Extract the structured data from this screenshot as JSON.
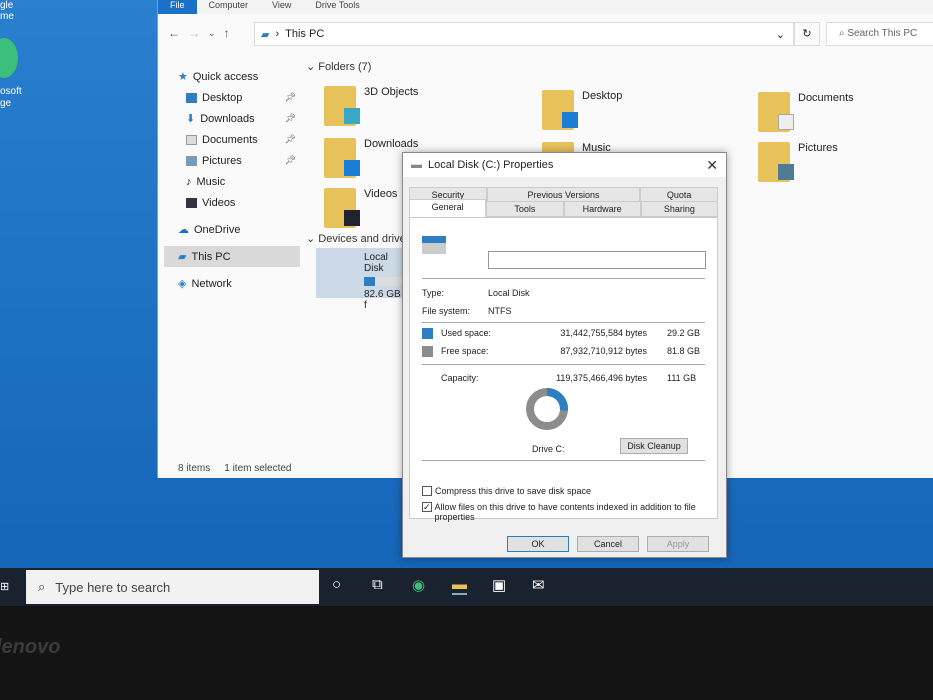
{
  "desktop": {
    "icons": [
      "gle",
      "me",
      "osoft",
      "ge"
    ]
  },
  "explorer": {
    "ribbon_tabs": [
      "File",
      "Computer",
      "View",
      "Drive Tools"
    ],
    "address": "This PC",
    "search_placeholder": "Search This PC",
    "nav": [
      {
        "label": "Quick access",
        "pinned": false
      },
      {
        "label": "Desktop",
        "pinned": true
      },
      {
        "label": "Downloads",
        "pinned": true
      },
      {
        "label": "Documents",
        "pinned": true
      },
      {
        "label": "Pictures",
        "pinned": true
      },
      {
        "label": "Music",
        "pinned": false
      },
      {
        "label": "Videos",
        "pinned": false
      },
      {
        "label": "OneDrive",
        "pinned": false
      },
      {
        "label": "This PC",
        "pinned": false
      },
      {
        "label": "Network",
        "pinned": false
      }
    ],
    "folders_header": "Folders (7)",
    "folders": [
      "3D Objects",
      "Desktop",
      "Documents",
      "Downloads",
      "Music",
      "Pictures",
      "Videos"
    ],
    "devices_header": "Devices and drives",
    "drive": {
      "name": "Local Disk",
      "free": "82.6 GB f",
      "used_fraction": 0.26
    },
    "status": {
      "items": "8 items",
      "selected": "1 item selected"
    }
  },
  "dialog": {
    "title": "Local Disk (C:) Properties",
    "tabs_back": [
      "Security",
      "Previous Versions",
      "Quota"
    ],
    "tabs_front": [
      "General",
      "Tools",
      "Hardware",
      "Sharing"
    ],
    "name_value": "",
    "type_label": "Type:",
    "type_value": "Local Disk",
    "fs_label": "File system:",
    "fs_value": "NTFS",
    "used_label": "Used space:",
    "used_bytes": "31,442,755,584 bytes",
    "used_gb": "29.2 GB",
    "free_label": "Free space:",
    "free_bytes": "87,932,710,912 bytes",
    "free_gb": "81.8 GB",
    "cap_label": "Capacity:",
    "cap_bytes": "119,375,466,496 bytes",
    "cap_gb": "111 GB",
    "used_fraction": 0.263,
    "used_color": "#2d7fc1",
    "free_color": "#8c8c8c",
    "drive_label": "Drive C:",
    "cleanup": "Disk Cleanup",
    "compress": "Compress this drive to save disk space",
    "index": "Allow files on this drive to have contents indexed in addition to file properties",
    "compress_checked": false,
    "index_checked": true,
    "ok": "OK",
    "cancel": "Cancel",
    "apply": "Apply"
  },
  "taskbar": {
    "search_placeholder": "Type here to search"
  },
  "bezel": {
    "brand": "Lenovo"
  }
}
